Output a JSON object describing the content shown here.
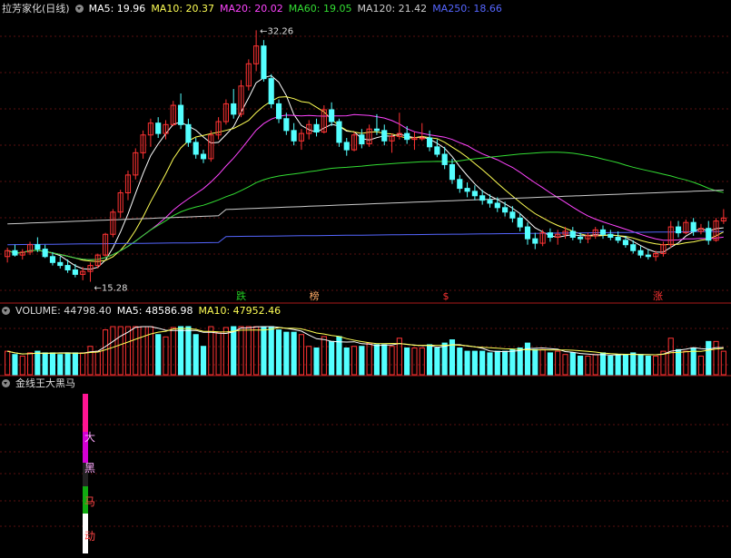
{
  "header": {
    "title": "拉芳家化(日线)",
    "ma": [
      {
        "label": "MA5: 19.96",
        "color": "#ffffff"
      },
      {
        "label": "MA10: 20.37",
        "color": "#ffff55"
      },
      {
        "label": "MA20: 20.02",
        "color": "#ff44ff"
      },
      {
        "label": "MA60: 19.05",
        "color": "#33dd33"
      },
      {
        "label": "MA120: 21.42",
        "color": "#cccccc"
      },
      {
        "label": "MA250: 18.66",
        "color": "#5566ff"
      }
    ]
  },
  "volume_header": {
    "title": "VOLUME: 44798.40",
    "ma5": "MA5: 48586.98",
    "ma10": "MA10: 47952.46"
  },
  "indicator_header": {
    "title": "金线王大黑马"
  },
  "markers": [
    {
      "text": "跌",
      "color": "#22cc22"
    },
    {
      "text": "榜",
      "color": "#ffaa66"
    },
    {
      "text": "$",
      "color": "#ff3333"
    },
    {
      "text": "涨",
      "color": "#ff3333"
    }
  ],
  "bar_labels": [
    "大",
    "黑",
    "马",
    "动"
  ],
  "annotations": {
    "high": "32.26",
    "low": "15.28"
  },
  "colors": {
    "up": "#ff3333",
    "down": "#54ffff",
    "grid": "#5a1010"
  },
  "chart_data": {
    "type": "candlestick",
    "title": "拉芳家化(日线)",
    "price_high": 32.26,
    "price_low": 15.28,
    "candles_ohlc_approx": [
      [
        17.0,
        17.6,
        16.6,
        17.4
      ],
      [
        17.4,
        17.8,
        17.0,
        17.1
      ],
      [
        17.1,
        17.5,
        16.8,
        17.3
      ],
      [
        17.3,
        18.0,
        17.1,
        17.8
      ],
      [
        17.8,
        18.3,
        17.3,
        17.5
      ],
      [
        17.5,
        17.8,
        16.9,
        17.0
      ],
      [
        17.0,
        17.3,
        16.4,
        16.6
      ],
      [
        16.6,
        17.0,
        16.2,
        16.4
      ],
      [
        16.4,
        16.8,
        15.9,
        16.1
      ],
      [
        16.1,
        16.5,
        15.6,
        15.8
      ],
      [
        15.8,
        16.3,
        15.4,
        16.0
      ],
      [
        16.0,
        16.6,
        15.3,
        16.4
      ],
      [
        16.4,
        17.2,
        16.2,
        17.1
      ],
      [
        17.1,
        18.6,
        17.0,
        18.5
      ],
      [
        18.5,
        20.2,
        18.3,
        20.0
      ],
      [
        20.0,
        21.5,
        19.6,
        21.3
      ],
      [
        21.3,
        22.8,
        20.8,
        22.5
      ],
      [
        22.5,
        24.3,
        22.2,
        24.0
      ],
      [
        24.0,
        25.5,
        23.6,
        25.2
      ],
      [
        25.2,
        26.3,
        24.4,
        26.0
      ],
      [
        26.0,
        26.4,
        25.0,
        25.3
      ],
      [
        25.3,
        26.2,
        24.9,
        25.9
      ],
      [
        25.9,
        27.5,
        25.8,
        27.2
      ],
      [
        27.2,
        28.0,
        25.6,
        25.9
      ],
      [
        25.9,
        26.3,
        24.4,
        24.7
      ],
      [
        24.7,
        25.0,
        23.6,
        23.9
      ],
      [
        23.9,
        24.2,
        23.3,
        23.6
      ],
      [
        23.6,
        25.5,
        23.4,
        25.2
      ],
      [
        25.2,
        26.4,
        24.9,
        26.1
      ],
      [
        26.1,
        27.6,
        25.9,
        27.3
      ],
      [
        27.3,
        28.3,
        26.3,
        26.6
      ],
      [
        26.6,
        28.9,
        26.4,
        28.5
      ],
      [
        28.5,
        30.3,
        28.2,
        30.0
      ],
      [
        30.0,
        32.26,
        29.5,
        31.2
      ],
      [
        31.2,
        31.6,
        28.8,
        29.0
      ],
      [
        29.0,
        29.3,
        27.0,
        27.3
      ],
      [
        27.3,
        27.6,
        26.0,
        26.3
      ],
      [
        26.3,
        26.7,
        25.2,
        25.5
      ],
      [
        25.5,
        26.0,
        24.5,
        24.8
      ],
      [
        24.8,
        25.6,
        24.2,
        25.3
      ],
      [
        25.3,
        26.2,
        24.9,
        25.9
      ],
      [
        25.9,
        26.3,
        25.1,
        25.4
      ],
      [
        25.4,
        27.2,
        25.3,
        26.9
      ],
      [
        26.9,
        27.4,
        25.8,
        26.1
      ],
      [
        26.1,
        26.3,
        24.4,
        24.7
      ],
      [
        24.7,
        25.0,
        23.8,
        24.2
      ],
      [
        24.2,
        25.4,
        24.1,
        25.2
      ],
      [
        25.2,
        25.6,
        24.3,
        24.6
      ],
      [
        24.6,
        25.9,
        24.4,
        25.6
      ],
      [
        25.6,
        26.6,
        25.2,
        25.5
      ],
      [
        25.5,
        25.9,
        24.5,
        24.8
      ],
      [
        24.8,
        25.3,
        24.0,
        25.1
      ],
      [
        25.1,
        26.7,
        24.9,
        25.3
      ],
      [
        25.3,
        25.8,
        24.6,
        24.9
      ],
      [
        24.9,
        25.4,
        24.2,
        25.0
      ],
      [
        25.0,
        26.0,
        24.8,
        25.0
      ],
      [
        25.0,
        25.5,
        24.1,
        24.4
      ],
      [
        24.4,
        24.9,
        23.7,
        23.9
      ],
      [
        23.9,
        24.4,
        22.9,
        23.2
      ],
      [
        23.2,
        23.6,
        21.9,
        22.2
      ],
      [
        22.2,
        22.5,
        21.3,
        21.6
      ],
      [
        21.6,
        22.0,
        21.0,
        21.4
      ],
      [
        21.4,
        21.8,
        20.8,
        21.1
      ],
      [
        21.1,
        21.5,
        20.5,
        20.8
      ],
      [
        20.8,
        21.2,
        20.3,
        20.6
      ],
      [
        20.6,
        21.0,
        20.0,
        20.3
      ],
      [
        20.3,
        20.7,
        19.7,
        20.0
      ],
      [
        20.0,
        20.4,
        19.3,
        19.6
      ],
      [
        19.6,
        19.9,
        18.7,
        19.0
      ],
      [
        19.0,
        19.3,
        17.8,
        18.2
      ],
      [
        18.2,
        18.6,
        17.5,
        17.9
      ],
      [
        17.9,
        18.8,
        17.7,
        18.6
      ],
      [
        18.6,
        18.9,
        18.0,
        18.3
      ],
      [
        18.3,
        18.8,
        17.8,
        18.5
      ],
      [
        18.5,
        19.0,
        18.2,
        18.7
      ],
      [
        18.7,
        19.0,
        18.1,
        18.3
      ],
      [
        18.3,
        18.6,
        17.9,
        18.2
      ],
      [
        18.2,
        18.6,
        17.9,
        18.4
      ],
      [
        18.4,
        19.0,
        18.2,
        18.8
      ],
      [
        18.8,
        19.1,
        18.2,
        18.5
      ],
      [
        18.5,
        18.8,
        18.1,
        18.3
      ],
      [
        18.3,
        18.7,
        17.9,
        18.1
      ],
      [
        18.1,
        18.4,
        17.6,
        17.8
      ],
      [
        17.8,
        18.1,
        17.2,
        17.4
      ],
      [
        17.4,
        17.7,
        16.9,
        17.1
      ],
      [
        17.1,
        17.5,
        16.8,
        17.0
      ],
      [
        17.0,
        17.4,
        16.7,
        17.2
      ],
      [
        17.2,
        18.0,
        17.0,
        17.8
      ],
      [
        17.8,
        19.4,
        17.6,
        19.0
      ],
      [
        19.0,
        19.4,
        18.3,
        18.6
      ],
      [
        18.6,
        19.5,
        18.5,
        19.3
      ],
      [
        19.3,
        19.6,
        18.4,
        18.7
      ],
      [
        18.7,
        19.2,
        18.5,
        18.9
      ],
      [
        18.9,
        19.4,
        17.8,
        18.1
      ],
      [
        18.1,
        19.6,
        18.0,
        19.4
      ],
      [
        19.4,
        20.2,
        19.2,
        19.6
      ]
    ]
  }
}
